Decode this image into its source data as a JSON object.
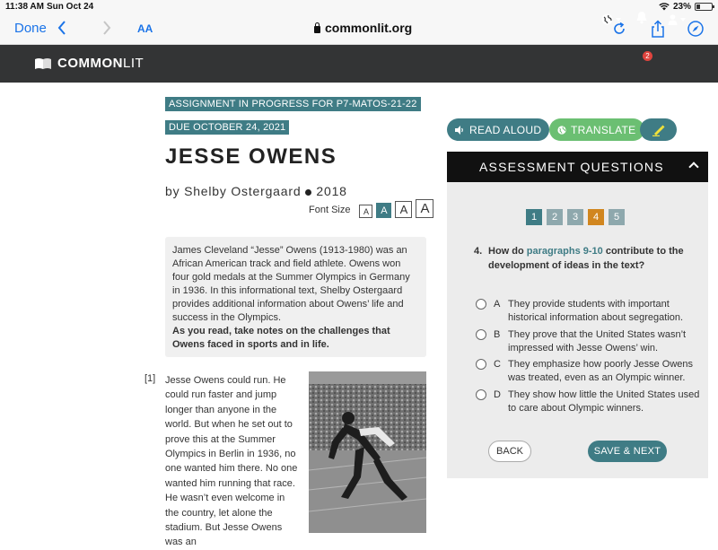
{
  "statusbar": {
    "time": "11:38 AM",
    "date": "Sun Oct 24",
    "battery": "23%",
    "battery_level": 0.23
  },
  "browser": {
    "done_label": "Done",
    "text_size_label": "AA",
    "url": "commonlit.org"
  },
  "header": {
    "logo_bold": "COMMON",
    "logo_light": "LIT",
    "notification_count": "2"
  },
  "article": {
    "assignment_badge": "ASSIGNMENT IN PROGRESS FOR P7-MATOS-21-22",
    "due_badge": "DUE OCTOBER 24, 2021",
    "title": "JESSE OWENS",
    "author": "by Shelby Ostergaard",
    "year": "2018",
    "font_size_label": "Font Size",
    "font_size_options": [
      "A",
      "A",
      "A",
      "A"
    ],
    "intro": "James Cleveland “Jesse” Owens (1913-1980) was an African American track and field athlete. Owens won four gold medals at the Summer Olympics in Germany in 1936. In this informational text, Shelby Ostergaard provides additional information about Owens’ life and success in the Olympics.",
    "intro_prompt": "As you read, take notes on the challenges that Owens faced in sports and in life.",
    "paragraph_number": "[1]",
    "paragraph_1": "Jesse Owens could run. He could run faster and jump longer than anyone in the world. But when he set out to prove this at the Summer Olympics in Berlin in 1936, no one wanted him there. No one wanted him running that race. He wasn’t even welcome in the country, let alone the stadium. But Jesse Owens was an"
  },
  "tools": {
    "read_aloud": "READ ALOUD",
    "translate": "TRANSLATE"
  },
  "assessment": {
    "header": "ASSESSMENT QUESTIONS",
    "question_numbers": [
      "1",
      "2",
      "3",
      "4",
      "5"
    ],
    "question_number": "4.",
    "question_pre": "How do ",
    "question_link": "paragraphs 9-10",
    "question_post": " contribute to the development of ideas in the text?",
    "options": [
      {
        "letter": "A",
        "text": "They provide students with important historical information about segregation."
      },
      {
        "letter": "B",
        "text": "They prove that the United States wasn’t impressed with Jesse Owens’ win."
      },
      {
        "letter": "C",
        "text": "They emphasize how poorly Jesse Owens was treated, even as an Olympic winner."
      },
      {
        "letter": "D",
        "text": "They show how little the United States used to care about Olympic winners."
      }
    ],
    "back_label": "BACK",
    "save_next_label": "SAVE & NEXT"
  },
  "colors": {
    "teal": "#3f7c85",
    "green": "#6bbf72",
    "current_question": "#d1861f",
    "header_bg": "#333435"
  }
}
